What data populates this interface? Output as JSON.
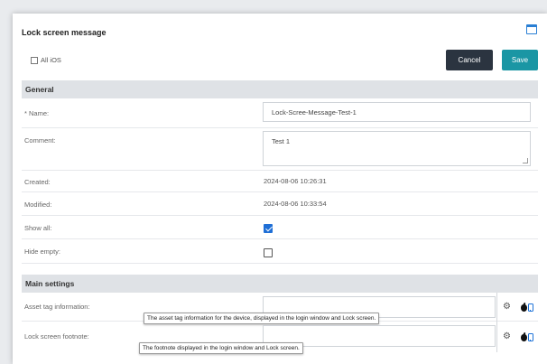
{
  "dialog": {
    "title": "Lock screen message",
    "all_ios_label": "All iOS"
  },
  "buttons": {
    "cancel": "Cancel",
    "save": "Save"
  },
  "general": {
    "header": "General",
    "name_label": "* Name:",
    "name_value": "Lock-Scree-Message-Test-1",
    "comment_label": "Comment:",
    "comment_value": "Test 1",
    "created_label": "Created:",
    "created_value": "2024-08-06 10:26:31",
    "modified_label": "Modified:",
    "modified_value": "2024-08-06 10:33:54",
    "show_all_label": "Show all:",
    "show_all_checked": true,
    "hide_empty_label": "Hide empty:",
    "hide_empty_checked": false
  },
  "main_settings": {
    "header": "Main settings",
    "asset_tag_label": "Asset tag information:",
    "asset_tag_value": "",
    "asset_tag_tooltip": "The asset tag information for the device, displayed in the login window and Lock screen.",
    "footnote_label": "Lock screen footnote:",
    "footnote_value": "",
    "footnote_tooltip": "The footnote displayed in the login window and Lock screen."
  },
  "icons": {
    "settings": "gear-icon",
    "platform_apple": "apple-icon",
    "platform_ipad": "ipad-icon",
    "window": "window-icon"
  },
  "colors": {
    "cancel_bg": "#2b3440",
    "save_bg": "#1a96a4",
    "section_bg": "#dfe2e6",
    "checkbox_checked": "#1f6fd6"
  }
}
